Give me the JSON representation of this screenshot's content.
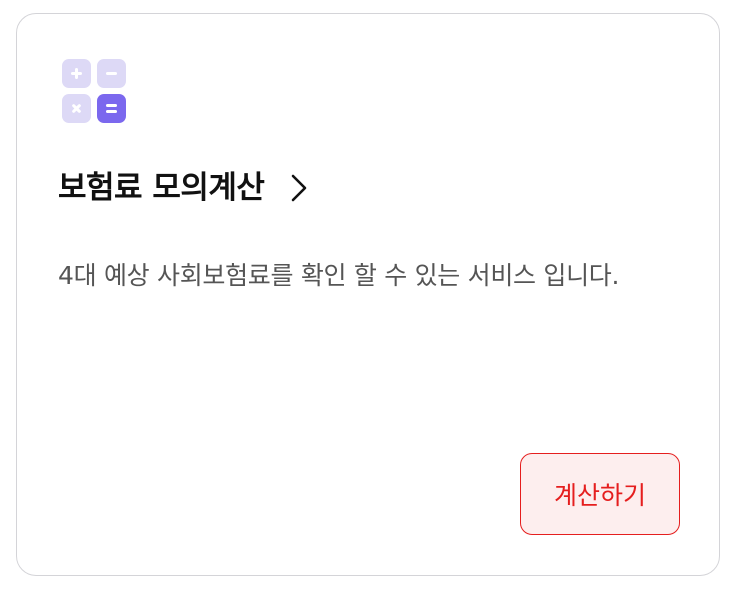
{
  "card": {
    "icon": "calculator-icon",
    "title": "보험료 모의계산",
    "chevron_icon": "chevron-right-icon",
    "description": "4대 예상 사회보험료를 확인 할 수 있는 서비스 입니다.",
    "button_label": "계산하기"
  },
  "colors": {
    "accent": "#e51e1e",
    "button_bg": "#fdeeee",
    "icon_light": "#ddd9f6",
    "icon_primary": "#7b68ee",
    "card_border": "#d4d4d8",
    "title_text": "#111111",
    "description_text": "#555555"
  }
}
